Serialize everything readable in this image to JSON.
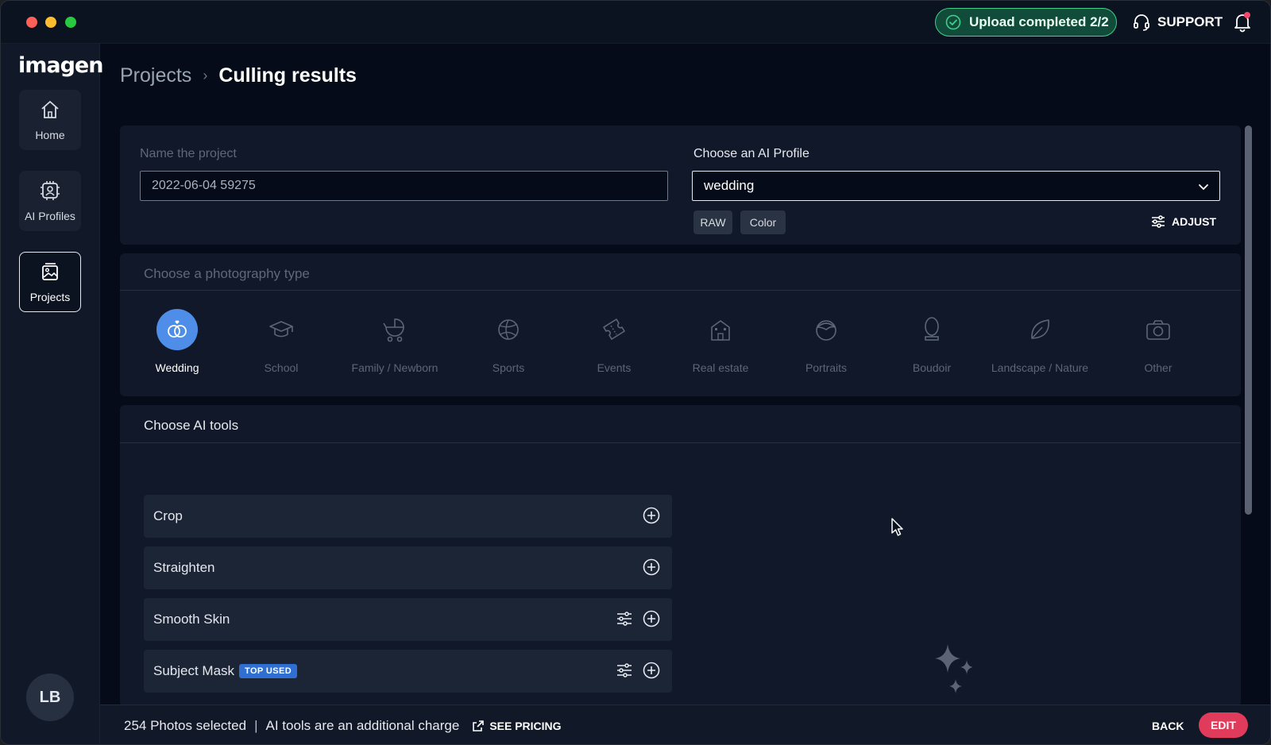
{
  "titlebar": {
    "upload_status": "Upload completed 2/2",
    "support_label": "SUPPORT"
  },
  "sidebar": {
    "logo": "imagen",
    "items": [
      {
        "label": "Home",
        "icon": "home-icon"
      },
      {
        "label": "AI Profiles",
        "icon": "ai-profiles-icon"
      },
      {
        "label": "Projects",
        "icon": "projects-icon",
        "active": true
      }
    ],
    "avatar_initials": "LB"
  },
  "breadcrumb": {
    "parent": "Projects",
    "separator": "›",
    "current": "Culling results"
  },
  "project": {
    "name_label": "Name the project",
    "name_value": "2022-06-04 59275",
    "profile_label": "Choose an AI Profile",
    "profile_value": "wedding",
    "tags": [
      "RAW",
      "Color"
    ],
    "adjust_label": "ADJUST"
  },
  "photography": {
    "title": "Choose a photography type",
    "types": [
      {
        "label": "Wedding",
        "icon": "wedding-rings-icon",
        "selected": true
      },
      {
        "label": "School",
        "icon": "graduation-cap-icon"
      },
      {
        "label": "Family / Newborn",
        "icon": "stroller-icon"
      },
      {
        "label": "Sports",
        "icon": "ball-icon"
      },
      {
        "label": "Events",
        "icon": "ticket-icon"
      },
      {
        "label": "Real estate",
        "icon": "building-icon"
      },
      {
        "label": "Portraits",
        "icon": "face-icon"
      },
      {
        "label": "Boudoir",
        "icon": "mirror-icon"
      },
      {
        "label": "Landscape / Nature",
        "icon": "leaf-icon"
      },
      {
        "label": "Other",
        "icon": "camera-icon"
      }
    ]
  },
  "ai_tools": {
    "title": "Choose AI tools",
    "tools": [
      {
        "label": "Crop",
        "has_settings": false
      },
      {
        "label": "Straighten",
        "has_settings": false
      },
      {
        "label": "Smooth Skin",
        "has_settings": true
      },
      {
        "label": "Subject Mask",
        "has_settings": true,
        "badge": "TOP USED"
      }
    ]
  },
  "footer": {
    "photos_selected": "254 Photos selected",
    "separator": "|",
    "charge_note": "AI tools are an additional charge",
    "see_pricing": "SEE PRICING",
    "back": "BACK",
    "edit": "EDIT"
  },
  "colors": {
    "accent_blue": "#4f8ee8",
    "edit_red": "#e13b5b",
    "upload_green": "#3fd08a",
    "badge_blue": "#2f6fd1"
  }
}
